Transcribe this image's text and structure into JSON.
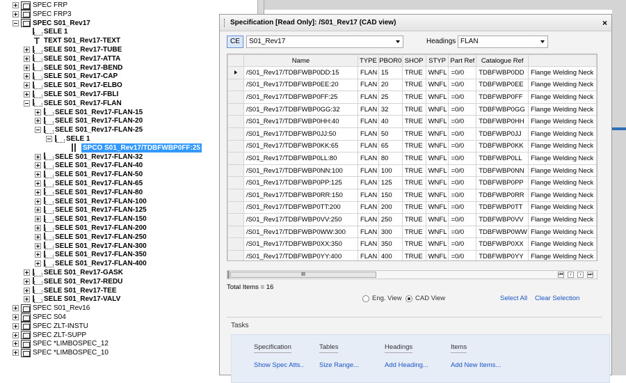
{
  "tree": {
    "nodes": [
      {
        "label": "SPEC FRP",
        "icon": "spec-icon",
        "exp": "plus",
        "indent": 0,
        "bold": false
      },
      {
        "label": "SPEC FRP3",
        "icon": "spec-icon",
        "exp": "plus",
        "indent": 0,
        "bold": false
      },
      {
        "label": "SPEC S01_Rev17",
        "icon": "spec-icon",
        "exp": "minus",
        "indent": 0,
        "bold": true
      },
      {
        "label": "SELE 1",
        "icon": "sele-icon",
        "exp": "none",
        "indent": 1,
        "bold": true
      },
      {
        "label": "TEXT S01_Rev17-TEXT",
        "icon": "text-icon",
        "exp": "none",
        "indent": 1,
        "bold": true
      },
      {
        "label": "SELE S01_Rev17-TUBE",
        "icon": "sele-icon",
        "exp": "plus",
        "indent": 1,
        "bold": true
      },
      {
        "label": "SELE S01_Rev17-ATTA",
        "icon": "sele-icon",
        "exp": "plus",
        "indent": 1,
        "bold": true
      },
      {
        "label": "SELE S01_Rev17-BEND",
        "icon": "sele-icon",
        "exp": "plus",
        "indent": 1,
        "bold": true
      },
      {
        "label": "SELE S01_Rev17-CAP",
        "icon": "sele-icon",
        "exp": "plus",
        "indent": 1,
        "bold": true
      },
      {
        "label": "SELE S01_Rev17-ELBO",
        "icon": "sele-icon",
        "exp": "plus",
        "indent": 1,
        "bold": true
      },
      {
        "label": "SELE S01_Rev17-FBLI",
        "icon": "sele-icon",
        "exp": "plus",
        "indent": 1,
        "bold": true
      },
      {
        "label": "SELE S01_Rev17-FLAN",
        "icon": "sele-icon",
        "exp": "minus",
        "indent": 1,
        "bold": true
      },
      {
        "label": "SELE S01_Rev17-FLAN-15",
        "icon": "sele-icon",
        "exp": "plus",
        "indent": 2,
        "bold": true
      },
      {
        "label": "SELE S01_Rev17-FLAN-20",
        "icon": "sele-icon",
        "exp": "plus",
        "indent": 2,
        "bold": true
      },
      {
        "label": "SELE S01_Rev17-FLAN-25",
        "icon": "sele-icon",
        "exp": "minus",
        "indent": 2,
        "bold": true
      },
      {
        "label": "SELE 1",
        "icon": "sele-icon",
        "exp": "minus",
        "indent": 3,
        "bold": true
      },
      {
        "label": "SPCO S01_Rev17/TDBFWBP0FF:25",
        "icon": "spco-icon",
        "exp": "none",
        "indent": 4,
        "bold": true,
        "selected": true
      },
      {
        "label": "SELE S01_Rev17-FLAN-32",
        "icon": "sele-icon",
        "exp": "plus",
        "indent": 2,
        "bold": true
      },
      {
        "label": "SELE S01_Rev17-FLAN-40",
        "icon": "sele-icon",
        "exp": "plus",
        "indent": 2,
        "bold": true
      },
      {
        "label": "SELE S01_Rev17-FLAN-50",
        "icon": "sele-icon",
        "exp": "plus",
        "indent": 2,
        "bold": true
      },
      {
        "label": "SELE S01_Rev17-FLAN-65",
        "icon": "sele-icon",
        "exp": "plus",
        "indent": 2,
        "bold": true
      },
      {
        "label": "SELE S01_Rev17-FLAN-80",
        "icon": "sele-icon",
        "exp": "plus",
        "indent": 2,
        "bold": true
      },
      {
        "label": "SELE S01_Rev17-FLAN-100",
        "icon": "sele-icon",
        "exp": "plus",
        "indent": 2,
        "bold": true
      },
      {
        "label": "SELE S01_Rev17-FLAN-125",
        "icon": "sele-icon",
        "exp": "plus",
        "indent": 2,
        "bold": true
      },
      {
        "label": "SELE S01_Rev17-FLAN-150",
        "icon": "sele-icon",
        "exp": "plus",
        "indent": 2,
        "bold": true
      },
      {
        "label": "SELE S01_Rev17-FLAN-200",
        "icon": "sele-icon",
        "exp": "plus",
        "indent": 2,
        "bold": true
      },
      {
        "label": "SELE S01_Rev17-FLAN-250",
        "icon": "sele-icon",
        "exp": "plus",
        "indent": 2,
        "bold": true
      },
      {
        "label": "SELE S01_Rev17-FLAN-300",
        "icon": "sele-icon",
        "exp": "plus",
        "indent": 2,
        "bold": true
      },
      {
        "label": "SELE S01_Rev17-FLAN-350",
        "icon": "sele-icon",
        "exp": "plus",
        "indent": 2,
        "bold": true
      },
      {
        "label": "SELE S01_Rev17-FLAN-400",
        "icon": "sele-icon",
        "exp": "plus",
        "indent": 2,
        "bold": true
      },
      {
        "label": "SELE S01_Rev17-GASK",
        "icon": "sele-icon",
        "exp": "plus",
        "indent": 1,
        "bold": true
      },
      {
        "label": "SELE S01_Rev17-REDU",
        "icon": "sele-icon",
        "exp": "plus",
        "indent": 1,
        "bold": true
      },
      {
        "label": "SELE S01_Rev17-TEE",
        "icon": "sele-icon",
        "exp": "plus",
        "indent": 1,
        "bold": true
      },
      {
        "label": "SELE S01_Rev17-VALV",
        "icon": "sele-icon",
        "exp": "plus",
        "indent": 1,
        "bold": true
      },
      {
        "label": "SPEC S01_Rev16",
        "icon": "spec-icon",
        "exp": "plus",
        "indent": 0,
        "bold": false
      },
      {
        "label": "SPEC S04",
        "icon": "spec-icon",
        "exp": "plus",
        "indent": 0,
        "bold": false
      },
      {
        "label": "SPEC ZLT-INSTU",
        "icon": "spec-icon",
        "exp": "plus",
        "indent": 0,
        "bold": false
      },
      {
        "label": "SPEC ZLT-SUPP",
        "icon": "spec-icon",
        "exp": "plus",
        "indent": 0,
        "bold": false
      },
      {
        "label": "SPEC *LIMBOSPEC_12",
        "icon": "spec-icon",
        "exp": "plus",
        "indent": 0,
        "bold": false
      },
      {
        "label": "SPEC *LIMBOSPEC_10",
        "icon": "spec-icon",
        "exp": "plus",
        "indent": 0,
        "bold": false
      }
    ]
  },
  "dialog": {
    "title": "Specification [Read Only]: /S01_Rev17 (CAD view)",
    "close": "×",
    "ce_label": "CE",
    "spec_value": "S01_Rev17",
    "headings_label": "Headings",
    "headings_value": "FLAN",
    "columns": [
      "",
      "Name",
      "TYPE",
      "PBOR0",
      "SHOP",
      "STYP",
      "Part Ref",
      "Catalogue Ref",
      ""
    ],
    "rows": [
      [
        "/S01_Rev17/TDBFWBP0DD:15",
        "FLAN",
        "15",
        "TRUE",
        "WNFL",
        "=0/0",
        "TDBFWBP0DD",
        "Flange Welding Neck"
      ],
      [
        "/S01_Rev17/TDBFWBP0EE:20",
        "FLAN",
        "20",
        "TRUE",
        "WNFL",
        "=0/0",
        "TDBFWBP0EE",
        "Flange Welding Neck"
      ],
      [
        "/S01_Rev17/TDBFWBP0FF:25",
        "FLAN",
        "25",
        "TRUE",
        "WNFL",
        "=0/0",
        "TDBFWBP0FF",
        "Flange Welding Neck"
      ],
      [
        "/S01_Rev17/TDBFWBP0GG:32",
        "FLAN",
        "32",
        "TRUE",
        "WNFL",
        "=0/0",
        "TDBFWBP0GG",
        "Flange Welding Neck"
      ],
      [
        "/S01_Rev17/TDBFWBP0HH:40",
        "FLAN",
        "40",
        "TRUE",
        "WNFL",
        "=0/0",
        "TDBFWBP0HH",
        "Flange Welding Neck"
      ],
      [
        "/S01_Rev17/TDBFWBP0JJ:50",
        "FLAN",
        "50",
        "TRUE",
        "WNFL",
        "=0/0",
        "TDBFWBP0JJ",
        "Flange Welding Neck"
      ],
      [
        "/S01_Rev17/TDBFWBP0KK:65",
        "FLAN",
        "65",
        "TRUE",
        "WNFL",
        "=0/0",
        "TDBFWBP0KK",
        "Flange Welding Neck"
      ],
      [
        "/S01_Rev17/TDBFWBP0LL:80",
        "FLAN",
        "80",
        "TRUE",
        "WNFL",
        "=0/0",
        "TDBFWBP0LL",
        "Flange Welding Neck"
      ],
      [
        "/S01_Rev17/TDBFWBP0NN:100",
        "FLAN",
        "100",
        "TRUE",
        "WNFL",
        "=0/0",
        "TDBFWBP0NN",
        "Flange Welding Neck"
      ],
      [
        "/S01_Rev17/TDBFWBP0PP:125",
        "FLAN",
        "125",
        "TRUE",
        "WNFL",
        "=0/0",
        "TDBFWBP0PP",
        "Flange Welding Neck"
      ],
      [
        "/S01_Rev17/TDBFWBP0RR:150",
        "FLAN",
        "150",
        "TRUE",
        "WNFL",
        "=0/0",
        "TDBFWBP0RR",
        "Flange Welding Neck"
      ],
      [
        "/S01_Rev17/TDBFWBP0TT:200",
        "FLAN",
        "200",
        "TRUE",
        "WNFL",
        "=0/0",
        "TDBFWBP0TT",
        "Flange Welding Neck"
      ],
      [
        "/S01_Rev17/TDBFWBP0VV:250",
        "FLAN",
        "250",
        "TRUE",
        "WNFL",
        "=0/0",
        "TDBFWBP0VV",
        "Flange Welding Neck"
      ],
      [
        "/S01_Rev17/TDBFWBP0WW:300",
        "FLAN",
        "300",
        "TRUE",
        "WNFL",
        "=0/0",
        "TDBFWBP0WW",
        "Flange Welding Neck"
      ],
      [
        "/S01_Rev17/TDBFWBP0XX:350",
        "FLAN",
        "350",
        "TRUE",
        "WNFL",
        "=0/0",
        "TDBFWBP0XX",
        "Flange Welding Neck"
      ],
      [
        "/S01_Rev17/TDBFWBP0YY:400",
        "FLAN",
        "400",
        "TRUE",
        "WNFL",
        "=0/0",
        "TDBFWBP0YY",
        "Flange Welding Neck"
      ]
    ],
    "scroll_thumb_label": "III",
    "nav_first": "⏮",
    "nav_prev": "‹",
    "nav_next": "›",
    "nav_last": "⏭",
    "total_items": "Total Items = 16",
    "eng_view_label": "Eng. View",
    "cad_view_label": "CAD View",
    "select_all": "Select All",
    "clear_selection": "Clear Selection",
    "tasks_title": "Tasks",
    "task_columns": [
      {
        "head": "Specification",
        "link": "Show Spec Atts.."
      },
      {
        "head": "Tables",
        "link": "Size Range..."
      },
      {
        "head": "Headings",
        "link": "Add Heading..."
      },
      {
        "head": "Items",
        "link": "Add New Items..."
      }
    ]
  }
}
